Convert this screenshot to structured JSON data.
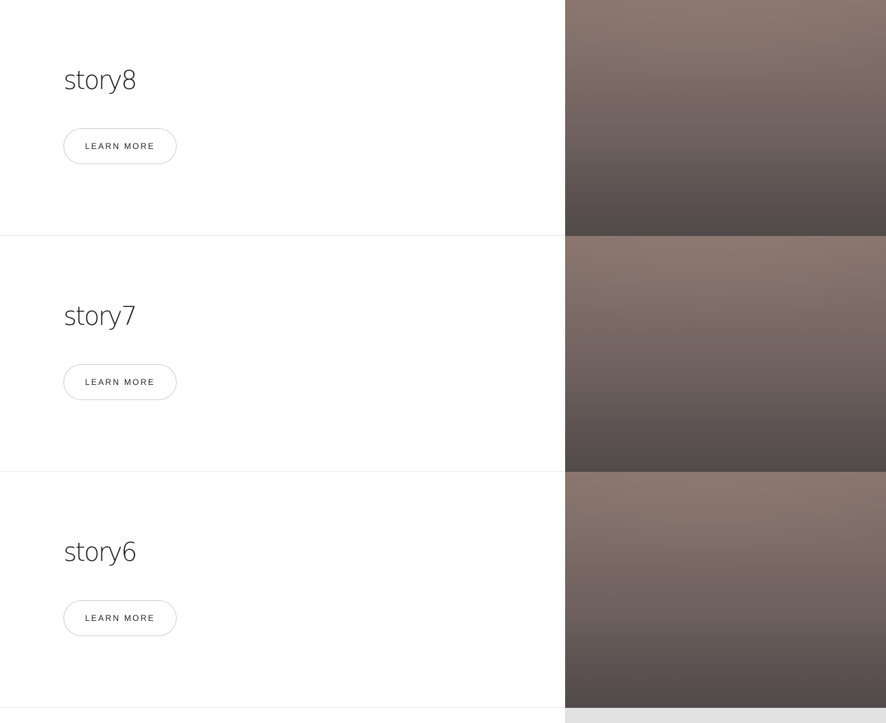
{
  "stories": [
    {
      "title": "story8",
      "button_label": "LEARN MORE"
    },
    {
      "title": "story7",
      "button_label": "LEARN MORE"
    },
    {
      "title": "story6",
      "button_label": "LEARN MORE"
    }
  ]
}
